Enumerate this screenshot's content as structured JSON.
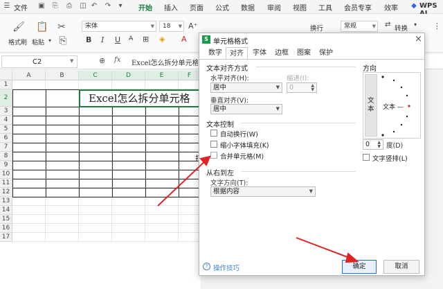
{
  "menubar": {
    "file": "文件",
    "tabs": [
      "开始",
      "插入",
      "页面",
      "公式",
      "数据",
      "审阅",
      "视图",
      "工具",
      "会员专享",
      "效率"
    ],
    "active_tab": "开始",
    "wps_ai": "WPS AI",
    "accent_color": "#1a7d3e"
  },
  "ribbon": {
    "format_painter": "格式刷",
    "paste": "粘贴",
    "font_name": "宋体",
    "font_size": "18",
    "bold": "B",
    "italic": "I",
    "underline": "U",
    "font_color_letter": "A",
    "wrap": "换行",
    "number_format": "常规",
    "convert": "转换"
  },
  "formula_bar": {
    "name_box": "C2",
    "fx": "fx",
    "content": "Excel怎么拆分单元格"
  },
  "sheet": {
    "columns": [
      "A",
      "B",
      "C",
      "D",
      "E",
      "F"
    ],
    "rows": [
      "1",
      "2",
      "3",
      "4",
      "5",
      "6",
      "7",
      "8",
      "9",
      "10",
      "11",
      "12",
      "13",
      "14",
      "15",
      "16",
      "17"
    ],
    "merged_text": "Excel怎么拆分单元格",
    "f8_char": "打"
  },
  "dialog": {
    "title": "单元格格式",
    "tabs": [
      "数字",
      "对齐",
      "字体",
      "边框",
      "图案",
      "保护"
    ],
    "active_tab": "对齐",
    "text_align_group": "文本对齐方式",
    "h_align_label": "水平对齐(H):",
    "h_align_value": "居中",
    "indent_label": "缩进(I):",
    "indent_value": "0",
    "v_align_label": "垂直对齐(V):",
    "v_align_value": "居中",
    "text_control_group": "文本控制",
    "wrap_text": "自动换行(W)",
    "shrink_fit": "缩小字体填充(K)",
    "merge_cells": "合并单元格(M)",
    "rtl_group": "从右到左",
    "text_direction_label": "文字方向(T):",
    "text_direction_value": "根据内容",
    "orientation_group": "方向",
    "orientation_vertical_text": "文本",
    "orientation_dial_text": "文本 —",
    "degree_value": "0",
    "degree_label": "度(D)",
    "vertical_text": "文字竖排(L)",
    "tips": "操作技巧",
    "ok": "确定",
    "cancel": "取消"
  },
  "colors": {
    "arrow": "#e02424",
    "ok_border": "#1f6fd1"
  }
}
